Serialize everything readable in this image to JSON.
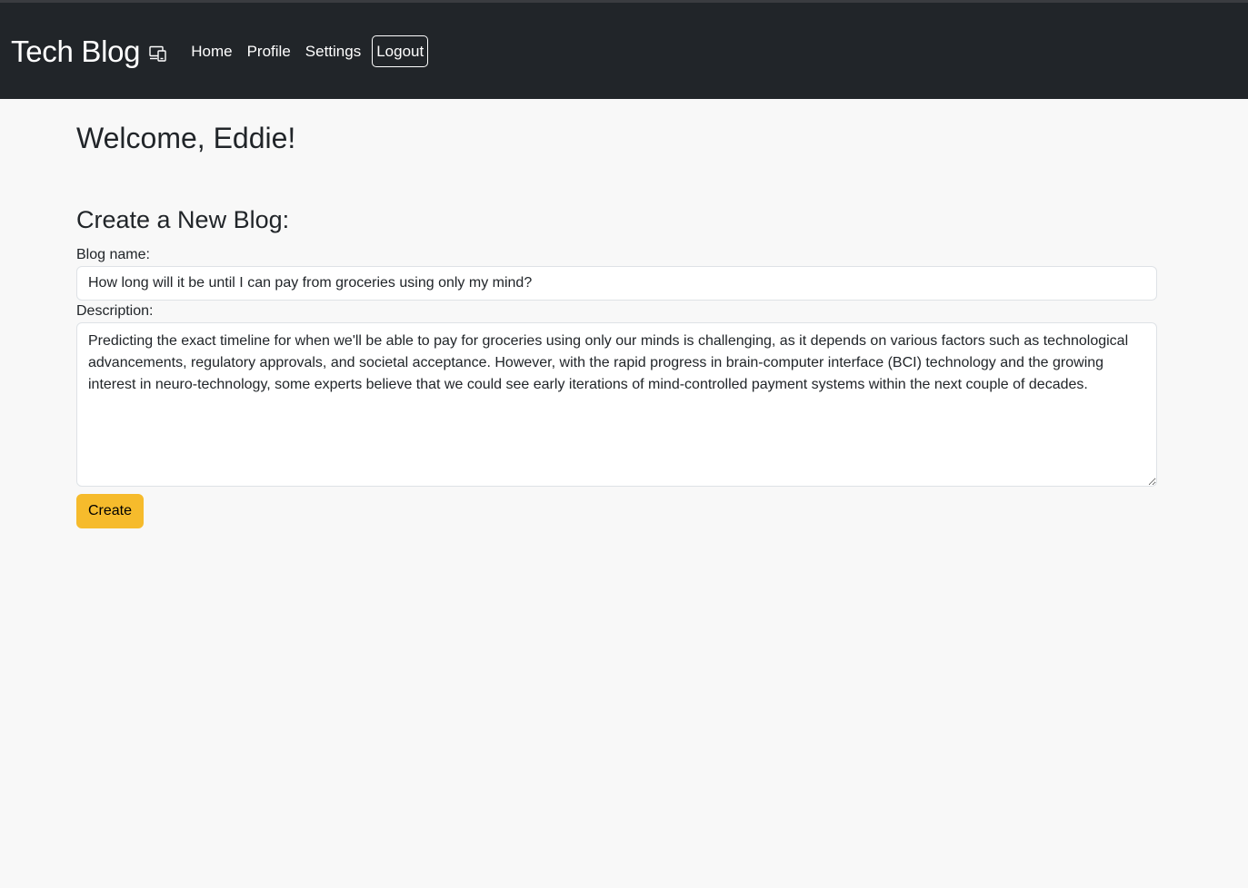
{
  "navbar": {
    "brand": "Tech Blog",
    "brand_icon": "devices-icon",
    "links": {
      "home": "Home",
      "profile": "Profile",
      "settings": "Settings",
      "logout": "Logout"
    }
  },
  "main": {
    "welcome": "Welcome, Eddie!",
    "create_heading": "Create a New Blog:",
    "form": {
      "name_label": "Blog name:",
      "name_value": "How long will it be until I can pay from groceries using only my mind?",
      "description_label": "Description:",
      "description_value": "Predicting the exact timeline for when we'll be able to pay for groceries using only our minds is challenging, as it depends on various factors such as technological advancements, regulatory approvals, and societal acceptance. However, with the rapid progress in brain-computer interface (BCI) technology and the growing interest in neuro-technology, some experts believe that we could see early iterations of mind-controlled payment systems within the next couple of decades.",
      "submit_label": "Create"
    }
  },
  "colors": {
    "navbar_bg": "#212529",
    "page_bg": "#f8f8f8",
    "button_bg": "#f6bb2c"
  }
}
